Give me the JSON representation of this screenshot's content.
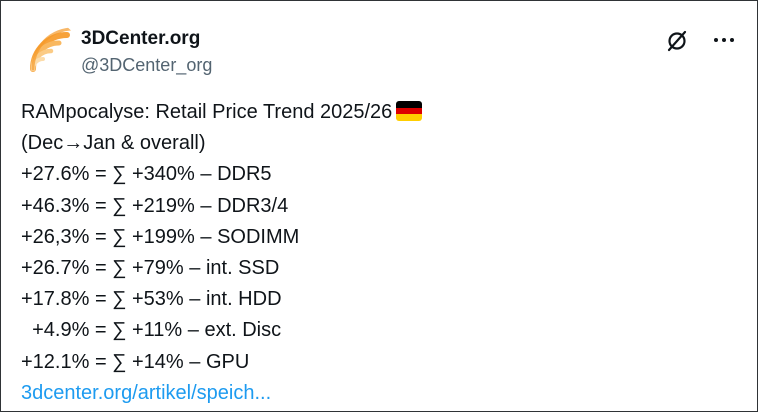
{
  "account": {
    "display_name": "3DCenter.org",
    "handle": "@3DCenter_org"
  },
  "icons": {
    "avatar": "3dcenter-logo",
    "grok": "grok-icon",
    "more": "more-horizontal-icon",
    "flag": "germany-flag"
  },
  "colors": {
    "link": "#1d9bf0",
    "logo_orange": "#f7a23a",
    "flag_black": "#000000",
    "flag_red": "#dd0000",
    "flag_gold": "#ffce00"
  },
  "post": {
    "title": "RAMpocalyse: Retail Price Trend 2025/26",
    "subtitle": "(Dec→Jan & overall)",
    "lines": [
      "+27.6% = ∑ +340% – DDR5",
      "+46.3% = ∑ +219% – DDR3/4",
      "+26,3% = ∑ +199% – SODIMM",
      "+26.7% = ∑ +79% – int. SSD",
      "+17.8% = ∑ +53% – int. HDD",
      "  +4.9% = ∑ +11% – ext. Disc",
      "+12.1% = ∑ +14% – GPU"
    ],
    "link": "3dcenter.org/artikel/speich..."
  }
}
